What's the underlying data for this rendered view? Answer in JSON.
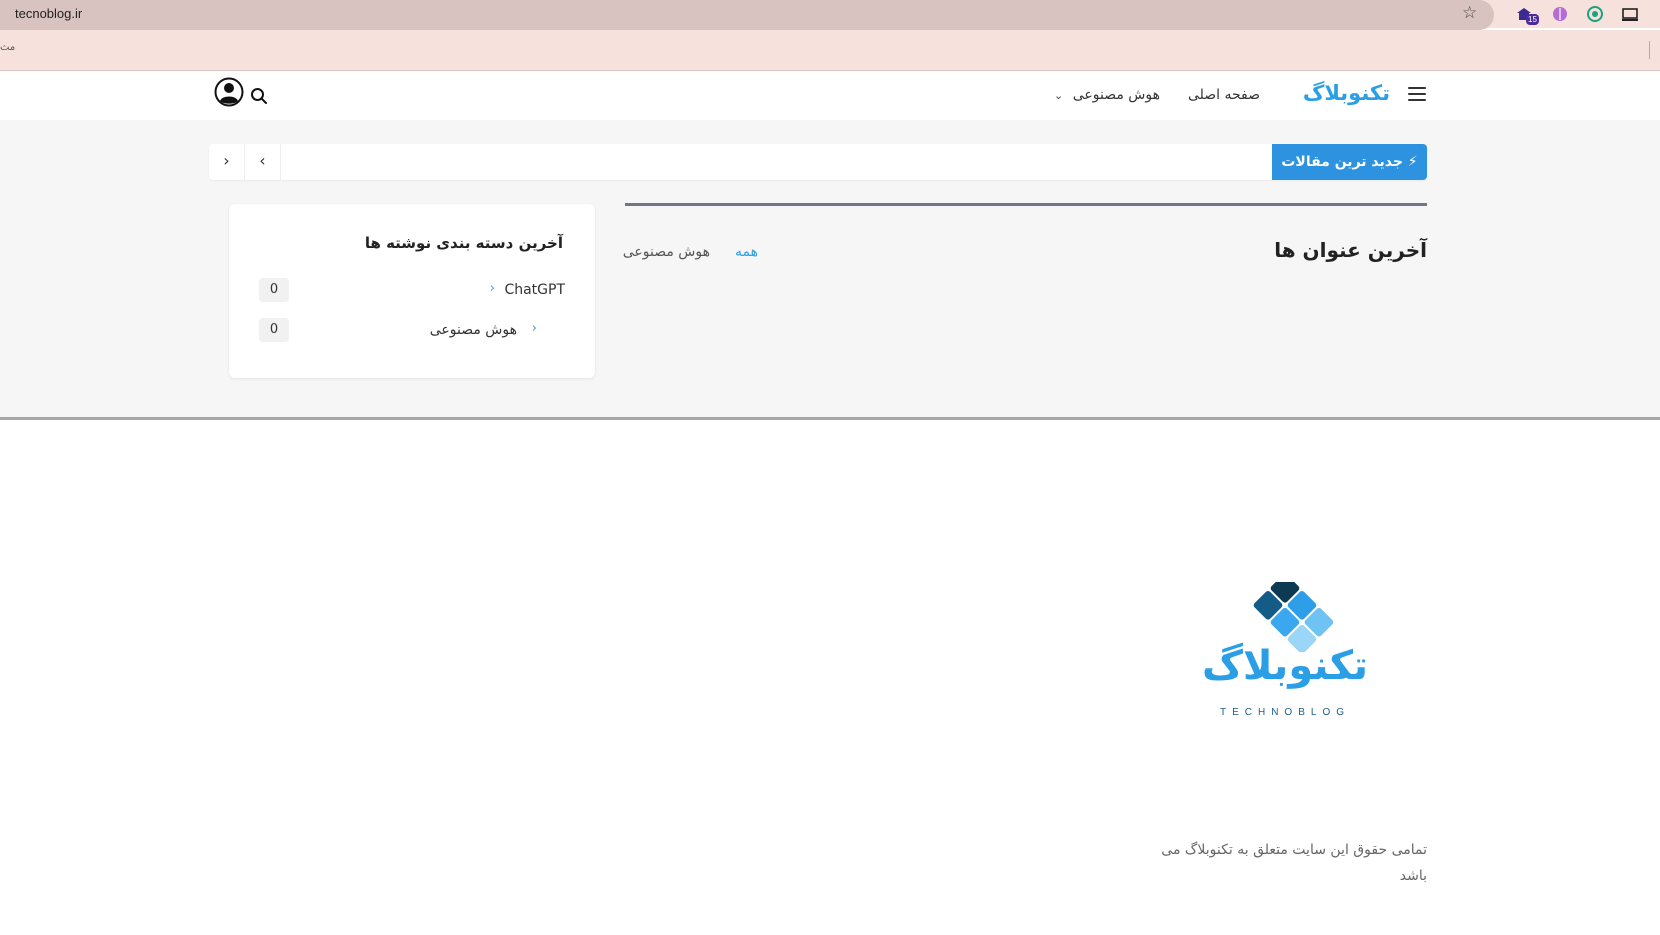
{
  "browser": {
    "url": "tecnoblog.ir",
    "extension_badge": "15",
    "bookmark_stub": "مث"
  },
  "header": {
    "brand": "تکنوبلاگ",
    "nav": {
      "home": "صفحه اصلی",
      "ai": "هوش مصنوعی"
    }
  },
  "ticker": {
    "label": "جدید ترین مقالات ⚡"
  },
  "latest": {
    "title": "آخرین عنوان ها",
    "filters": {
      "all": "همه",
      "ai": "هوش مصنوعی"
    }
  },
  "categories": {
    "title": "آخرین دسته بندی نوشته ها",
    "items": [
      {
        "label": "ChatGPT",
        "count": "0"
      },
      {
        "label": "هوش مصنوعی",
        "count": "0"
      }
    ]
  },
  "footer": {
    "logo_wordmark": "تکنوبلاگ",
    "logo_sub": "TECHNOBLOG",
    "copyright": "تمامی حقوق این سایت متعلق به تکنوبلاگ می باشد"
  },
  "colors": {
    "accent": "#2b9fe6",
    "ticker_bg": "#2d93e0",
    "chrome_bg": "#f7e1dc"
  }
}
